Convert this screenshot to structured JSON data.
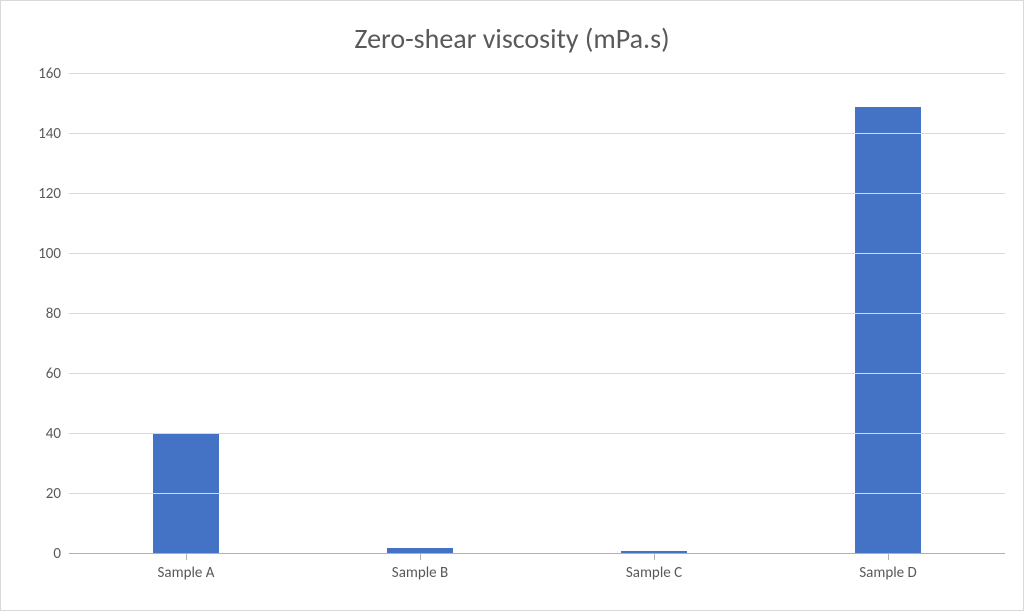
{
  "chart_data": {
    "type": "bar",
    "title": "Zero-shear viscosity (mPa.s)",
    "categories": [
      "Sample A",
      "Sample B",
      "Sample C",
      "Sample D"
    ],
    "values": [
      40,
      2,
      1,
      149
    ],
    "xlabel": "",
    "ylabel": "",
    "ylim": [
      0,
      160
    ],
    "y_ticks": [
      0,
      20,
      40,
      60,
      80,
      100,
      120,
      140,
      160
    ],
    "bar_color": "#4472c4",
    "grid_color": "#d9d9d9"
  }
}
